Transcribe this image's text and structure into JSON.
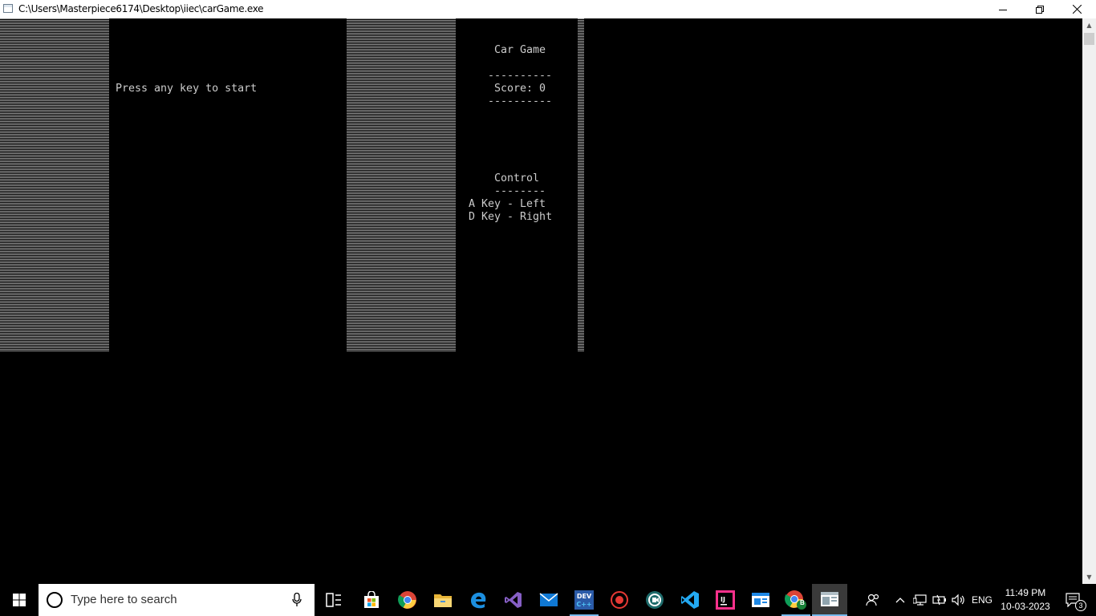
{
  "window": {
    "title": "C:\\Users\\Masterpiece6174\\Desktop\\iiec\\carGame.exe",
    "minimize_icon": "minimize-icon",
    "restore_icon": "restore-icon",
    "close_icon": "close-icon"
  },
  "game": {
    "start_prompt": "Press any key to start",
    "heading": "Car Game",
    "divider_top": "----------",
    "score_label": "Score: 0",
    "divider_bottom": "----------",
    "control_heading": "Control",
    "control_divider": "--------",
    "control_left": "A Key - Left",
    "control_right": "D Key - Right"
  },
  "taskbar": {
    "search_placeholder": "Type here to search",
    "icons": [
      "windows-start-icon",
      "cortana-circle-icon",
      "microphone-icon",
      "task-view-icon",
      "microsoft-store-icon",
      "chrome-icon",
      "file-explorer-icon",
      "edge-icon",
      "visual-studio-icon",
      "mail-icon",
      "dev-cpp-icon",
      "screen-recorder-icon",
      "meet-camera-icon",
      "vscode-icon",
      "intellij-icon",
      "app-window-icon",
      "chrome-profile-icon",
      "console-app-icon"
    ],
    "chrome_profile_badge": "B",
    "language": "ENG",
    "time": "11:49 PM",
    "date": "10-03-2023",
    "notification_count": "3"
  },
  "colors": {
    "console_bg": "#000000",
    "console_text": "#cccccc",
    "taskbar_bg": "#000000",
    "accent": "#76b9ed"
  }
}
